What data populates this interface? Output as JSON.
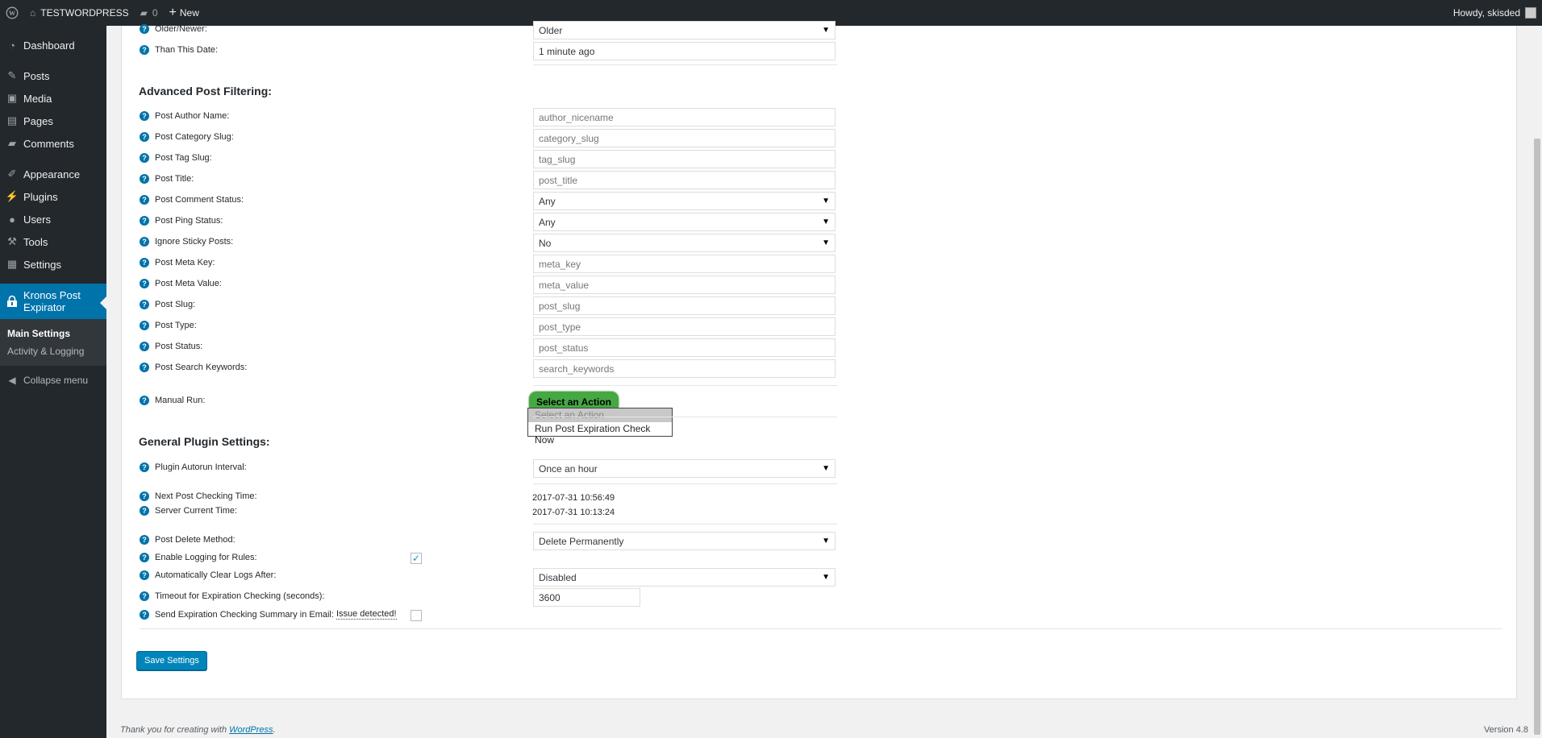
{
  "admin_bar": {
    "site_name": "TESTWORDPRESS",
    "comments_count": "0",
    "new_label": "New",
    "howdy": "Howdy, skisded"
  },
  "sidebar": {
    "items": [
      {
        "label": "Dashboard",
        "icon": "dashboard-icon"
      },
      {
        "label": "Posts",
        "icon": "pin-icon"
      },
      {
        "label": "Media",
        "icon": "media-icon"
      },
      {
        "label": "Pages",
        "icon": "pages-icon"
      },
      {
        "label": "Comments",
        "icon": "comment-icon"
      },
      {
        "label": "Appearance",
        "icon": "brush-icon"
      },
      {
        "label": "Plugins",
        "icon": "plug-icon"
      },
      {
        "label": "Users",
        "icon": "user-icon"
      },
      {
        "label": "Tools",
        "icon": "wrench-icon"
      },
      {
        "label": "Settings",
        "icon": "settings-icon"
      }
    ],
    "current": "Kronos Post Expirator",
    "submenu": [
      "Main Settings",
      "Activity & Logging"
    ],
    "collapse": "Collapse menu"
  },
  "top_fields": [
    {
      "label": "Older/Newer:",
      "value": "Older",
      "select": true
    },
    {
      "label": "Than This Date:",
      "value": "1 minute ago",
      "select": false
    }
  ],
  "advanced": {
    "heading": "Advanced Post Filtering:",
    "fields": [
      {
        "label": "Post Author Name:",
        "value": "author_nicename",
        "select": false
      },
      {
        "label": "Post Category Slug:",
        "value": "category_slug",
        "select": false
      },
      {
        "label": "Post Tag Slug:",
        "value": "tag_slug",
        "select": false
      },
      {
        "label": "Post Title:",
        "value": "post_title",
        "select": false
      },
      {
        "label": "Post Comment Status:",
        "value": "Any",
        "select": true
      },
      {
        "label": "Post Ping Status:",
        "value": "Any",
        "select": true
      },
      {
        "label": "Ignore Sticky Posts:",
        "value": "No",
        "select": true
      },
      {
        "label": "Post Meta Key:",
        "value": "meta_key",
        "select": false
      },
      {
        "label": "Post Meta Value:",
        "value": "meta_value",
        "select": false
      },
      {
        "label": "Post Slug:",
        "value": "post_slug",
        "select": false
      },
      {
        "label": "Post Type:",
        "value": "post_type",
        "select": false
      },
      {
        "label": "Post Status:",
        "value": "post_status",
        "select": false
      },
      {
        "label": "Post Search Keywords:",
        "value": "search_keywords",
        "select": false
      }
    ]
  },
  "manual_run": {
    "label": "Manual Run:",
    "button": "Select an Action",
    "options": [
      "Select an Action",
      "Run Post Expiration Check Now"
    ]
  },
  "general": {
    "heading": "General Plugin Settings:",
    "autorun_label": "Plugin Autorun Interval:",
    "autorun_value": "Once an hour",
    "next_check_label": "Next Post Checking Time:",
    "next_check_value": "2017-07-31 10:56:49",
    "server_time_label": "Server Current Time:",
    "server_time_value": "2017-07-31 10:13:24",
    "delete_method_label": "Post Delete Method:",
    "delete_method_value": "Delete Permanently",
    "logging_label": "Enable Logging for Rules:",
    "logging_checked": true,
    "clear_logs_label": "Automatically Clear Logs After:",
    "clear_logs_value": "Disabled",
    "timeout_label": "Timeout for Expiration Checking (seconds):",
    "timeout_value": "3600",
    "email_label": "Send Expiration Checking Summary in Email:",
    "email_issue": "Issue detected!",
    "email_checked": false
  },
  "save_label": "Save Settings",
  "footer": {
    "thanks": "Thank you for creating with",
    "link": "WordPress",
    "version": "Version 4.8"
  },
  "colors": {
    "admin_dark": "#23282d",
    "accent": "#0073aa",
    "action_green": "#46a843"
  }
}
